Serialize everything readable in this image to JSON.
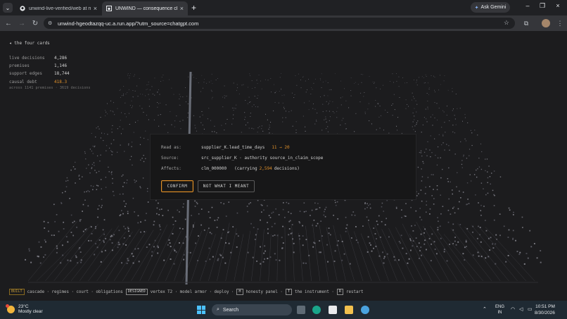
{
  "browser": {
    "tabs": [
      {
        "title": "unwind-live-verified/web at ma",
        "icon": "github-icon",
        "active": false
      },
      {
        "title": "UNWIND — consequence clea",
        "icon": "unwind-icon",
        "active": true
      }
    ],
    "new_tab": "+",
    "gemini_label": "Ask Gemini",
    "url": "unwind-hgeodtazqq-uc.a.run.app/?utm_source=chatgpt.com"
  },
  "page": {
    "back_link": "◂ the four cards",
    "stats": [
      {
        "label": "live decisions",
        "value": "4,286"
      },
      {
        "label": "premises",
        "value": "1,146"
      },
      {
        "label": "support edges",
        "value": "18,744"
      },
      {
        "label": "causal debt",
        "value": "418.3"
      }
    ],
    "stats_note": "across 1141 premises · 3619 decisions",
    "dialog": {
      "read_as_label": "Read as:",
      "read_as_value": "supplier_K.lead_time_days",
      "read_as_range": "11 → 20",
      "source_label": "Source:",
      "source_value": "src_supplier_K · authority source_in_claim_scope",
      "affects_label": "Affects:",
      "affects_id": "clm_000000",
      "affects_prefix": "(carrying",
      "affects_count": "2,594",
      "affects_suffix": "decisions)",
      "confirm_label": "CONFIRM",
      "not_meant_label": "NOT WHAT I MEANT"
    },
    "legend": {
      "built_tag": "BUILT",
      "built_items": "cascade · regimes · court · obligations",
      "designed_tag": "DESIGNED",
      "designed_items": "vertex T2 · model armor · deploy ·",
      "key_h": "H",
      "key_h_label": "honesty panel ·",
      "key_t": "T",
      "key_t_label": "the instrument ·",
      "key_r": "R",
      "key_r_label": "restart"
    },
    "accent_color": "#e0902a"
  },
  "taskbar": {
    "temperature": "23°C",
    "condition": "Mostly clear",
    "search_placeholder": "Search",
    "language": "ENG",
    "region": "IN",
    "time": "10:51 PM",
    "date": "8/30/2026"
  }
}
